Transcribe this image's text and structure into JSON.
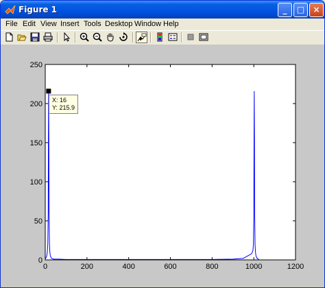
{
  "window": {
    "title": "Figure 1",
    "buttons": {
      "minimize": "_",
      "maximize": "□",
      "close": "×"
    }
  },
  "menu": [
    "File",
    "Edit",
    "View",
    "Insert",
    "Tools",
    "Desktop",
    "Window",
    "Help"
  ],
  "toolbar": [
    "new-figure-icon",
    "open-file-icon",
    "save-icon",
    "print-icon",
    "edit-plot-arrow-icon",
    "zoom-in-icon",
    "zoom-out-icon",
    "pan-hand-icon",
    "rotate-3d-icon",
    "data-cursor-icon",
    "insert-colorbar-icon",
    "insert-legend-icon",
    "hide-plot-tools-icon",
    "show-plot-tools-icon"
  ],
  "colors": {
    "line": "#0000ff",
    "plot_bg": "#ffffff",
    "figure_bg": "#c8c8c8",
    "datatip_bg": "#ffffe1"
  },
  "datatip": {
    "x_text": "X: 16",
    "y_text": "Y: 215.9"
  },
  "chart_data": {
    "type": "line",
    "xlim": [
      0,
      1200
    ],
    "ylim": [
      0,
      250
    ],
    "xticks": [
      0,
      200,
      400,
      600,
      800,
      1000,
      1200
    ],
    "yticks": [
      0,
      50,
      100,
      150,
      200,
      250
    ],
    "grid": false,
    "series": [
      {
        "x": [
          0,
          2,
          4,
          6,
          8,
          10,
          12,
          14,
          15,
          16,
          17,
          18,
          20,
          22,
          24,
          26,
          28,
          30,
          40,
          60,
          100,
          200,
          400,
          600,
          800,
          900,
          950,
          990,
          996,
          998,
          1000,
          1001,
          1002,
          1003,
          1004,
          1006,
          1008,
          1010,
          1012,
          1014,
          1016,
          1018,
          1020,
          1024
        ],
        "y": [
          2,
          2,
          3,
          4,
          6,
          10,
          20,
          60,
          160,
          215.9,
          158,
          60,
          22,
          10,
          6,
          4,
          3,
          2,
          1,
          1,
          0.5,
          0.5,
          0.5,
          0.5,
          0.5,
          1,
          2,
          8,
          12,
          20,
          60,
          157,
          215.9,
          157,
          60,
          20,
          10,
          6,
          4,
          3,
          2,
          2,
          1,
          1
        ]
      }
    ]
  }
}
